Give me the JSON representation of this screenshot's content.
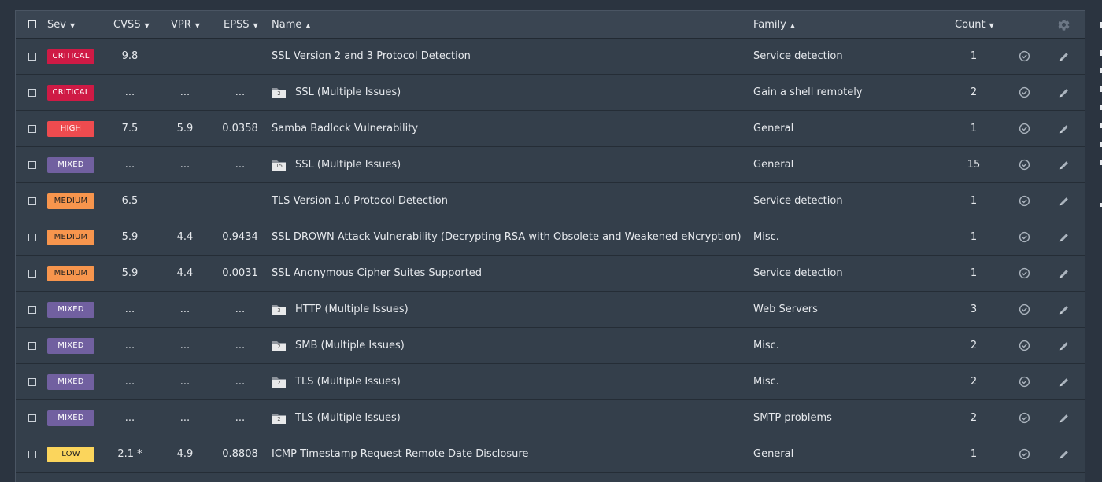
{
  "columns": {
    "sev": "Sev",
    "cvss": "CVSS",
    "vpr": "VPR",
    "epss": "EPSS",
    "name": "Name",
    "family": "Family",
    "count": "Count"
  },
  "sort_indicators": {
    "sev": "▼",
    "cvss": "▼",
    "vpr": "▼",
    "epss": "▼",
    "name": "▲",
    "family": "▲",
    "count": "▼"
  },
  "severity_colors": {
    "CRITICAL": "#cf1a45",
    "HIGH": "#ee4b4f",
    "MIXED": "#7160a0",
    "MEDIUM": "#f7954d",
    "LOW": "#fbd55c"
  },
  "rows": [
    {
      "sev": "CRITICAL",
      "cvss": "9.8",
      "vpr": "",
      "epss": "",
      "name": "SSL Version 2 and 3 Protocol Detection",
      "folder": "",
      "family": "Service detection",
      "count": "1"
    },
    {
      "sev": "CRITICAL",
      "cvss": "...",
      "vpr": "...",
      "epss": "...",
      "name": "SSL (Multiple Issues)",
      "folder": "2",
      "family": "Gain a shell remotely",
      "count": "2"
    },
    {
      "sev": "HIGH",
      "cvss": "7.5",
      "vpr": "5.9",
      "epss": "0.0358",
      "name": "Samba Badlock Vulnerability",
      "folder": "",
      "family": "General",
      "count": "1"
    },
    {
      "sev": "MIXED",
      "cvss": "...",
      "vpr": "...",
      "epss": "...",
      "name": "SSL (Multiple Issues)",
      "folder": "15",
      "family": "General",
      "count": "15"
    },
    {
      "sev": "MEDIUM",
      "cvss": "6.5",
      "vpr": "",
      "epss": "",
      "name": "TLS Version 1.0 Protocol Detection",
      "folder": "",
      "family": "Service detection",
      "count": "1"
    },
    {
      "sev": "MEDIUM",
      "cvss": "5.9",
      "vpr": "4.4",
      "epss": "0.9434",
      "name": "SSL DROWN Attack Vulnerability (Decrypting RSA with Obsolete and Weakened eNcryption)",
      "folder": "",
      "family": "Misc.",
      "count": "1"
    },
    {
      "sev": "MEDIUM",
      "cvss": "5.9",
      "vpr": "4.4",
      "epss": "0.0031",
      "name": "SSL Anonymous Cipher Suites Supported",
      "folder": "",
      "family": "Service detection",
      "count": "1"
    },
    {
      "sev": "MIXED",
      "cvss": "...",
      "vpr": "...",
      "epss": "...",
      "name": "HTTP (Multiple Issues)",
      "folder": "3",
      "family": "Web Servers",
      "count": "3"
    },
    {
      "sev": "MIXED",
      "cvss": "...",
      "vpr": "...",
      "epss": "...",
      "name": "SMB (Multiple Issues)",
      "folder": "2",
      "family": "Misc.",
      "count": "2"
    },
    {
      "sev": "MIXED",
      "cvss": "...",
      "vpr": "...",
      "epss": "...",
      "name": "TLS (Multiple Issues)",
      "folder": "2",
      "family": "Misc.",
      "count": "2"
    },
    {
      "sev": "MIXED",
      "cvss": "...",
      "vpr": "...",
      "epss": "...",
      "name": "TLS (Multiple Issues)",
      "folder": "2",
      "family": "SMTP problems",
      "count": "2"
    },
    {
      "sev": "LOW",
      "cvss": "2.1 *",
      "vpr": "4.9",
      "epss": "0.8808",
      "name": "ICMP Timestamp Request Remote Date Disclosure",
      "folder": "",
      "family": "General",
      "count": "1"
    }
  ]
}
